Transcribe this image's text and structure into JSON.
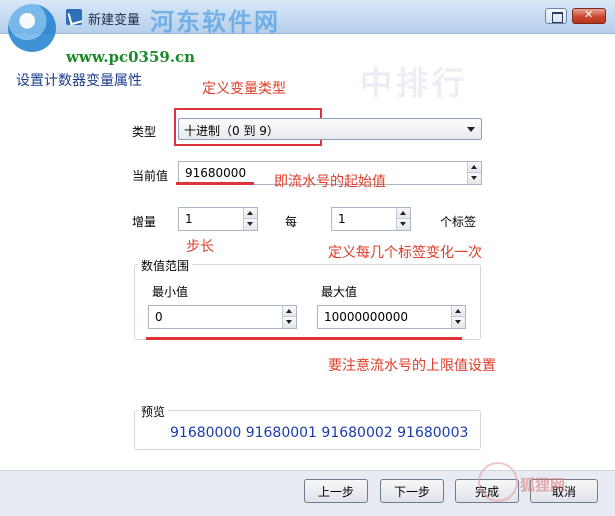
{
  "window": {
    "title": "新建变量",
    "watermark_top": "河东软件网",
    "url": "www.pc0359.cn",
    "watermark_mid": "中排行",
    "icons": [
      "app-icon",
      "restore-icon",
      "close-icon"
    ]
  },
  "page": {
    "title": "设置计数器变量属性"
  },
  "annotations": {
    "type_note": "定义变量类型",
    "start_note": "即流水号的起始值",
    "step_note": "步长",
    "every_note": "定义每几个标签变化一次",
    "limit_note": "要注意流水号的上限值设置",
    "color": "#e03c2a"
  },
  "form": {
    "type_label": "类型",
    "type_value": "十进制（0 到 9）",
    "current_label": "当前值",
    "current_value": "91680000",
    "increment_label": "增量",
    "increment_value": "1",
    "every_label": "每",
    "every_value": "1",
    "labels_suffix": "个标签"
  },
  "range": {
    "group_label": "数值范围",
    "min_label": "最小值",
    "min_value": "0",
    "max_label": "最大值",
    "max_value": "10000000000"
  },
  "preview": {
    "group_label": "预览",
    "text": "91680000 91680001 91680002 91680003",
    "color": "#1a3cb0"
  },
  "footer": {
    "prev": "上一步",
    "next": "下一步",
    "finish": "完成",
    "cancel": "取消",
    "watermark": "狐狸网"
  }
}
